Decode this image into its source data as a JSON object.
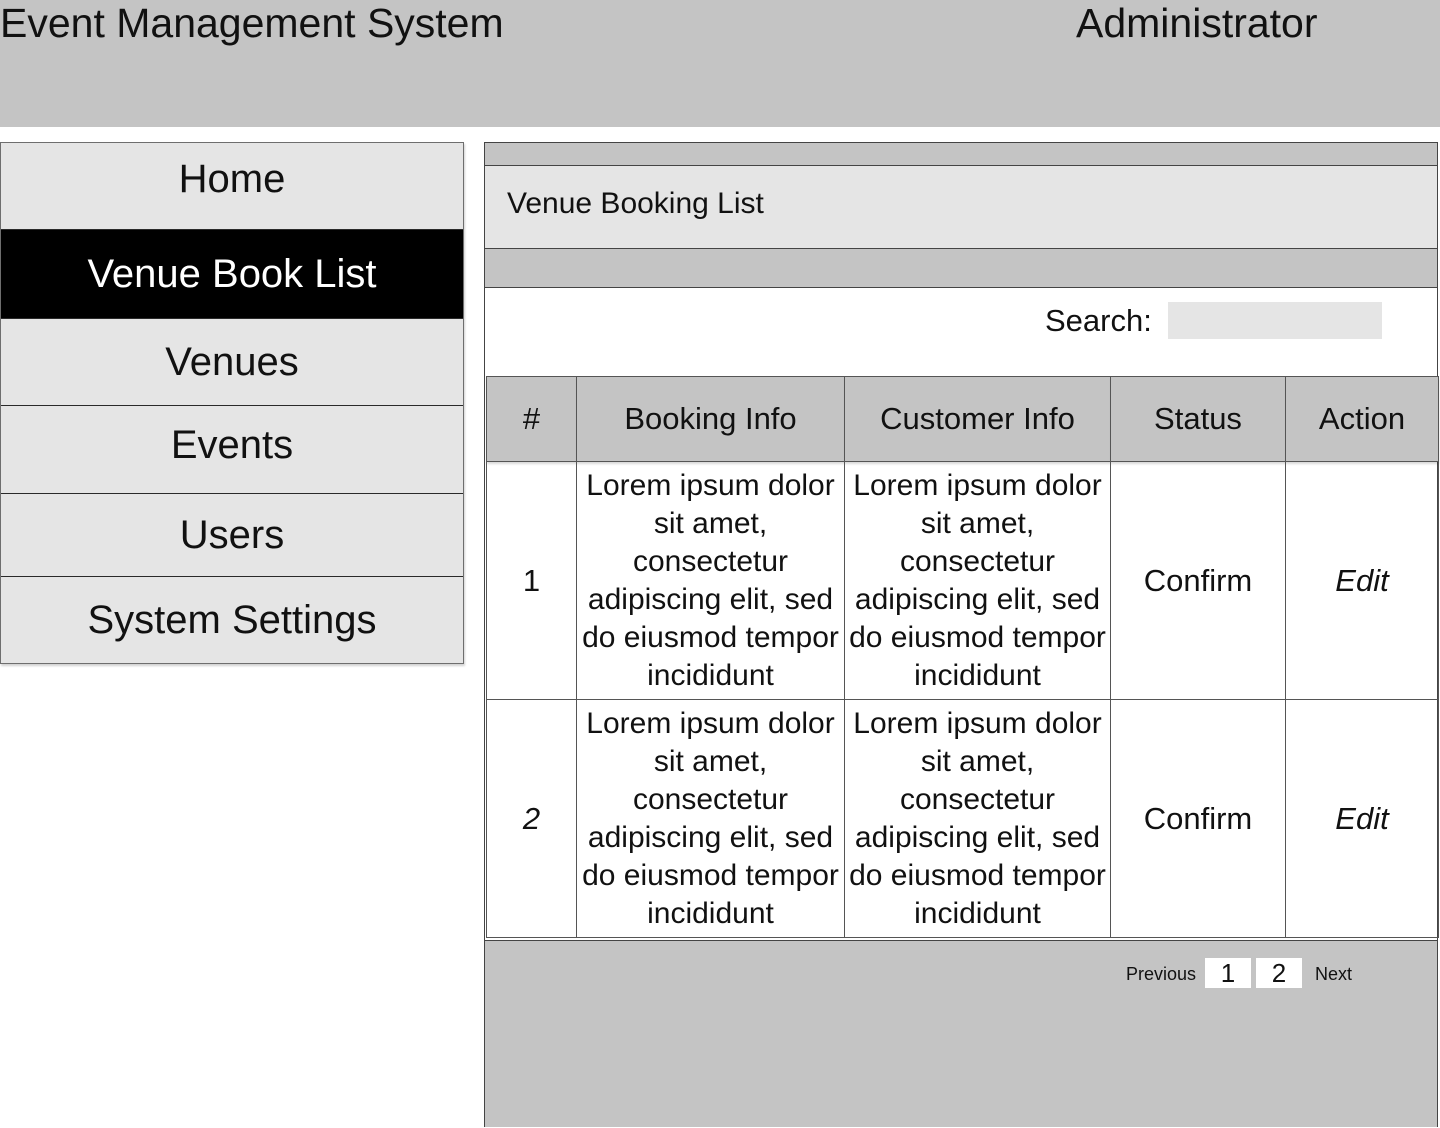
{
  "header": {
    "app_title": "Event Management System",
    "user_name": "Administrator"
  },
  "sidebar": {
    "items": [
      {
        "label": "Home",
        "active": false
      },
      {
        "label": "Venue Book List",
        "active": true
      },
      {
        "label": "Venues",
        "active": false
      },
      {
        "label": "Events",
        "active": false
      },
      {
        "label": "Users",
        "active": false
      },
      {
        "label": "System Settings",
        "active": false
      }
    ]
  },
  "main": {
    "title": "Venue Booking List",
    "search": {
      "label": "Search:",
      "value": "",
      "placeholder": ""
    },
    "table": {
      "columns": [
        "#",
        "Booking Info",
        "Customer Info",
        "Status",
        "Action"
      ],
      "rows": [
        {
          "num": "1",
          "booking_info": "Lorem ipsum dolor sit amet, consectetur adipiscing elit, sed do eiusmod tempor incididunt",
          "customer_info": "Lorem ipsum dolor sit amet, consectetur adipiscing elit, sed do eiusmod tempor incididunt",
          "status": "Confirm",
          "action": "Edit"
        },
        {
          "num": "2",
          "booking_info": "Lorem ipsum dolor sit amet, consectetur adipiscing elit, sed do eiusmod tempor incididunt",
          "customer_info": "Lorem ipsum dolor sit amet, consectetur adipiscing elit, sed do eiusmod tempor incididunt",
          "status": "Confirm",
          "action": "Edit"
        }
      ]
    },
    "pagination": {
      "previous_label": "Previous",
      "pages": [
        "1",
        "2"
      ],
      "next_label": "Next"
    }
  },
  "colors": {
    "header_bg": "#c4c4c4",
    "nav_bg": "#e5e5e5",
    "nav_active_bg": "#000000",
    "nav_active_text": "#ffffff",
    "panel_bar": "#c4c4c4"
  }
}
